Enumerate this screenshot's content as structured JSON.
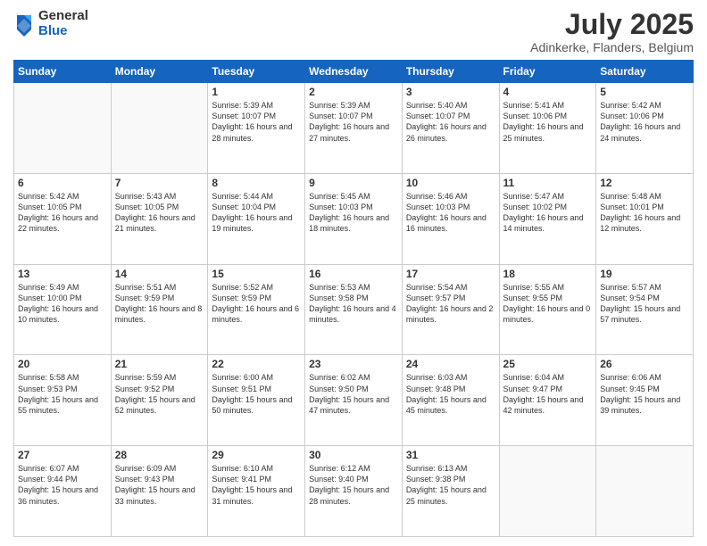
{
  "logo": {
    "general": "General",
    "blue": "Blue"
  },
  "header": {
    "month": "July 2025",
    "location": "Adinkerke, Flanders, Belgium"
  },
  "weekdays": [
    "Sunday",
    "Monday",
    "Tuesday",
    "Wednesday",
    "Thursday",
    "Friday",
    "Saturday"
  ],
  "weeks": [
    [
      {
        "day": "",
        "text": ""
      },
      {
        "day": "",
        "text": ""
      },
      {
        "day": "1",
        "text": "Sunrise: 5:39 AM\nSunset: 10:07 PM\nDaylight: 16 hours\nand 28 minutes."
      },
      {
        "day": "2",
        "text": "Sunrise: 5:39 AM\nSunset: 10:07 PM\nDaylight: 16 hours\nand 27 minutes."
      },
      {
        "day": "3",
        "text": "Sunrise: 5:40 AM\nSunset: 10:07 PM\nDaylight: 16 hours\nand 26 minutes."
      },
      {
        "day": "4",
        "text": "Sunrise: 5:41 AM\nSunset: 10:06 PM\nDaylight: 16 hours\nand 25 minutes."
      },
      {
        "day": "5",
        "text": "Sunrise: 5:42 AM\nSunset: 10:06 PM\nDaylight: 16 hours\nand 24 minutes."
      }
    ],
    [
      {
        "day": "6",
        "text": "Sunrise: 5:42 AM\nSunset: 10:05 PM\nDaylight: 16 hours\nand 22 minutes."
      },
      {
        "day": "7",
        "text": "Sunrise: 5:43 AM\nSunset: 10:05 PM\nDaylight: 16 hours\nand 21 minutes."
      },
      {
        "day": "8",
        "text": "Sunrise: 5:44 AM\nSunset: 10:04 PM\nDaylight: 16 hours\nand 19 minutes."
      },
      {
        "day": "9",
        "text": "Sunrise: 5:45 AM\nSunset: 10:03 PM\nDaylight: 16 hours\nand 18 minutes."
      },
      {
        "day": "10",
        "text": "Sunrise: 5:46 AM\nSunset: 10:03 PM\nDaylight: 16 hours\nand 16 minutes."
      },
      {
        "day": "11",
        "text": "Sunrise: 5:47 AM\nSunset: 10:02 PM\nDaylight: 16 hours\nand 14 minutes."
      },
      {
        "day": "12",
        "text": "Sunrise: 5:48 AM\nSunset: 10:01 PM\nDaylight: 16 hours\nand 12 minutes."
      }
    ],
    [
      {
        "day": "13",
        "text": "Sunrise: 5:49 AM\nSunset: 10:00 PM\nDaylight: 16 hours\nand 10 minutes."
      },
      {
        "day": "14",
        "text": "Sunrise: 5:51 AM\nSunset: 9:59 PM\nDaylight: 16 hours\nand 8 minutes."
      },
      {
        "day": "15",
        "text": "Sunrise: 5:52 AM\nSunset: 9:59 PM\nDaylight: 16 hours\nand 6 minutes."
      },
      {
        "day": "16",
        "text": "Sunrise: 5:53 AM\nSunset: 9:58 PM\nDaylight: 16 hours\nand 4 minutes."
      },
      {
        "day": "17",
        "text": "Sunrise: 5:54 AM\nSunset: 9:57 PM\nDaylight: 16 hours\nand 2 minutes."
      },
      {
        "day": "18",
        "text": "Sunrise: 5:55 AM\nSunset: 9:55 PM\nDaylight: 16 hours\nand 0 minutes."
      },
      {
        "day": "19",
        "text": "Sunrise: 5:57 AM\nSunset: 9:54 PM\nDaylight: 15 hours\nand 57 minutes."
      }
    ],
    [
      {
        "day": "20",
        "text": "Sunrise: 5:58 AM\nSunset: 9:53 PM\nDaylight: 15 hours\nand 55 minutes."
      },
      {
        "day": "21",
        "text": "Sunrise: 5:59 AM\nSunset: 9:52 PM\nDaylight: 15 hours\nand 52 minutes."
      },
      {
        "day": "22",
        "text": "Sunrise: 6:00 AM\nSunset: 9:51 PM\nDaylight: 15 hours\nand 50 minutes."
      },
      {
        "day": "23",
        "text": "Sunrise: 6:02 AM\nSunset: 9:50 PM\nDaylight: 15 hours\nand 47 minutes."
      },
      {
        "day": "24",
        "text": "Sunrise: 6:03 AM\nSunset: 9:48 PM\nDaylight: 15 hours\nand 45 minutes."
      },
      {
        "day": "25",
        "text": "Sunrise: 6:04 AM\nSunset: 9:47 PM\nDaylight: 15 hours\nand 42 minutes."
      },
      {
        "day": "26",
        "text": "Sunrise: 6:06 AM\nSunset: 9:45 PM\nDaylight: 15 hours\nand 39 minutes."
      }
    ],
    [
      {
        "day": "27",
        "text": "Sunrise: 6:07 AM\nSunset: 9:44 PM\nDaylight: 15 hours\nand 36 minutes."
      },
      {
        "day": "28",
        "text": "Sunrise: 6:09 AM\nSunset: 9:43 PM\nDaylight: 15 hours\nand 33 minutes."
      },
      {
        "day": "29",
        "text": "Sunrise: 6:10 AM\nSunset: 9:41 PM\nDaylight: 15 hours\nand 31 minutes."
      },
      {
        "day": "30",
        "text": "Sunrise: 6:12 AM\nSunset: 9:40 PM\nDaylight: 15 hours\nand 28 minutes."
      },
      {
        "day": "31",
        "text": "Sunrise: 6:13 AM\nSunset: 9:38 PM\nDaylight: 15 hours\nand 25 minutes."
      },
      {
        "day": "",
        "text": ""
      },
      {
        "day": "",
        "text": ""
      }
    ]
  ]
}
